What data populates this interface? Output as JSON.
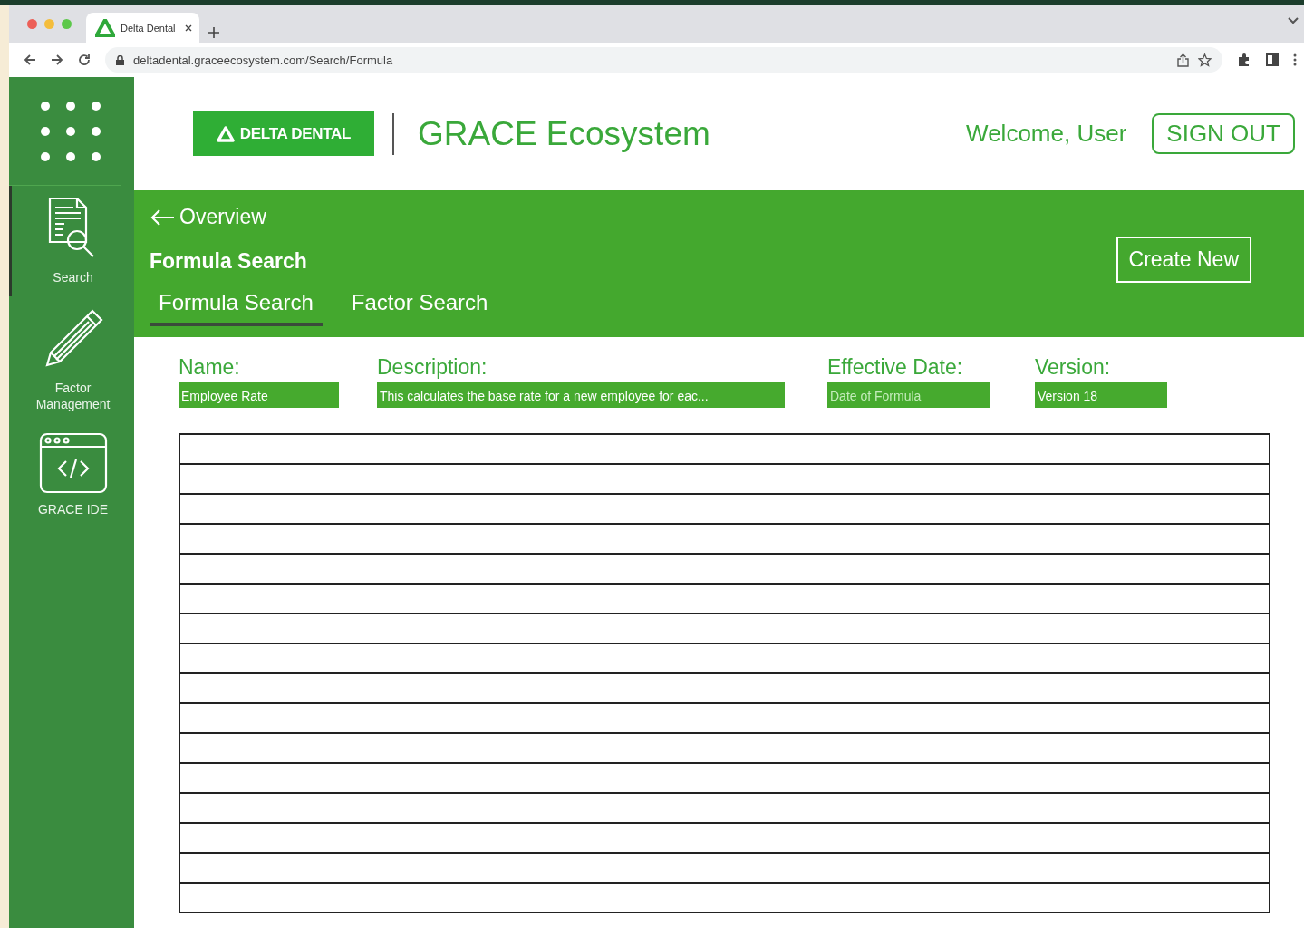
{
  "browser": {
    "tab_title": "Delta Dental",
    "url": "deltadental.graceecosystem.com/Search/Formula"
  },
  "sidebar": {
    "items": [
      {
        "kind": "search",
        "label": "Search",
        "selected": true
      },
      {
        "kind": "pencil",
        "label": "Factor Management",
        "selected": false
      },
      {
        "kind": "code",
        "label": "GRACE IDE",
        "selected": false
      }
    ]
  },
  "header": {
    "logo": "DELTA DENTAL",
    "app_title": "GRACE Ecosystem",
    "welcome": "Welcome, User",
    "sign_out": "SIGN OUT"
  },
  "band": {
    "back_link": "Overview",
    "page_title": "Formula Search",
    "create_button": "Create New",
    "tabs": [
      {
        "label": "Formula Search",
        "selected": true
      },
      {
        "label": "Factor Search",
        "selected": false
      }
    ]
  },
  "filters": [
    {
      "label": "Name:",
      "value": "Employee Rate"
    },
    {
      "label": "Description:",
      "value": "This calculates the base rate for a new employee for eac..."
    },
    {
      "label": "Effective Date:",
      "placeholder": "Date of Formula"
    },
    {
      "label": "Version:",
      "value": "Version 18"
    }
  ]
}
